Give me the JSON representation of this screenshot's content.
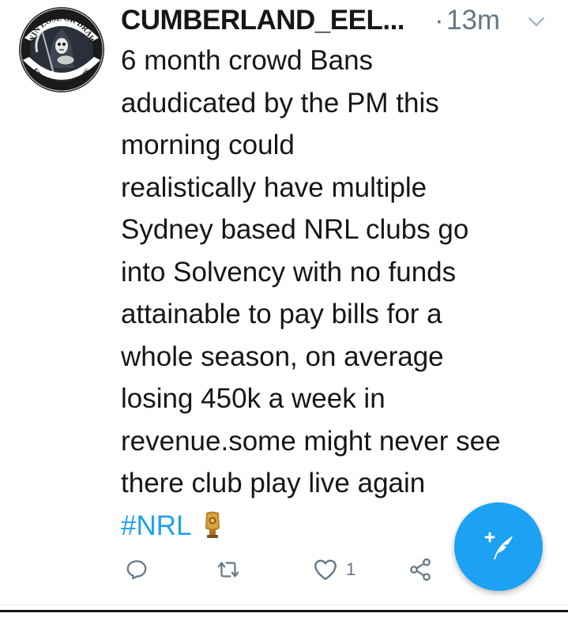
{
  "tweet": {
    "author": {
      "display_name": "CUMBERLAND_EEL...",
      "avatar_text_top": "WIN LOSE OR DRAW",
      "avatar_text_bottom": "EELS FAN TILL I DIE"
    },
    "separator": "·",
    "timestamp": "13m",
    "body_lines": [
      "6 month crowd Bans",
      "adudicated by the PM this",
      "morning could",
      "realistically have multiple",
      "Sydney based NRL clubs go",
      "into Solvency with no funds",
      "attainable to pay bills for a",
      "whole season, on average",
      "losing 450k a week in",
      "revenue.some might never see",
      "there club play live again"
    ],
    "hashtag": "#NRL",
    "actions": {
      "reply_icon": "reply-icon",
      "retweet_icon": "retweet-icon",
      "like_icon": "heart-icon",
      "like_count": "1",
      "share_icon": "share-icon"
    }
  },
  "compose_button": {
    "icon": "compose-tweet-icon",
    "color": "#1da1f2"
  },
  "colors": {
    "text": "#14171a",
    "muted": "#657786",
    "accent": "#1da1f2"
  }
}
